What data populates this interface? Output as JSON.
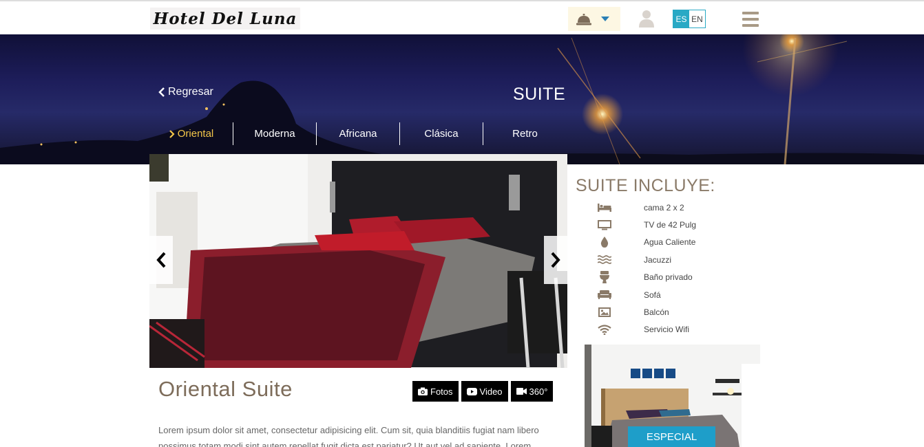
{
  "header": {
    "logo_text": "Hotel Del Luna",
    "language": {
      "active": "ES",
      "inactive": "EN"
    }
  },
  "hero": {
    "back_label": "Regresar",
    "title": "SUITE",
    "tabs": [
      {
        "label": "Oriental",
        "active": true
      },
      {
        "label": "Moderna",
        "active": false
      },
      {
        "label": "Africana",
        "active": false
      },
      {
        "label": "Clásica",
        "active": false
      },
      {
        "label": "Retro",
        "active": false
      }
    ]
  },
  "room": {
    "title": "Oriental Suite",
    "buttons": {
      "photos": "Fotos",
      "video": "Video",
      "view360": "360°"
    },
    "description": "Lorem ipsum dolor sit amet, consectetur adipisicing elit. Cum sit, quia blanditiis fugiat nam libero possimus totam modi sint autem repellat fugit dicta est pariatur? Ut aut vel ad sapiente. Lorem"
  },
  "includes": {
    "title": "SUITE INCLUYE:",
    "items": [
      {
        "icon": "bed-icon",
        "label": "cama 2 x 2"
      },
      {
        "icon": "tv-icon",
        "label": "TV de 42 Pulg"
      },
      {
        "icon": "water-drop-icon",
        "label": "Agua Caliente"
      },
      {
        "icon": "waves-icon",
        "label": "Jacuzzi"
      },
      {
        "icon": "toilet-icon",
        "label": "Baño privado"
      },
      {
        "icon": "sofa-icon",
        "label": "Sofá"
      },
      {
        "icon": "image-icon",
        "label": "Balcón"
      },
      {
        "icon": "wifi-icon",
        "label": "Servicio Wifi"
      }
    ]
  },
  "special": {
    "label": "ESPECIAL"
  },
  "colors": {
    "accent_blue": "#29a9c5",
    "brown_text": "#7d6c5a",
    "active_tab": "#f4c74a",
    "icon_brown": "#8a7a68"
  }
}
